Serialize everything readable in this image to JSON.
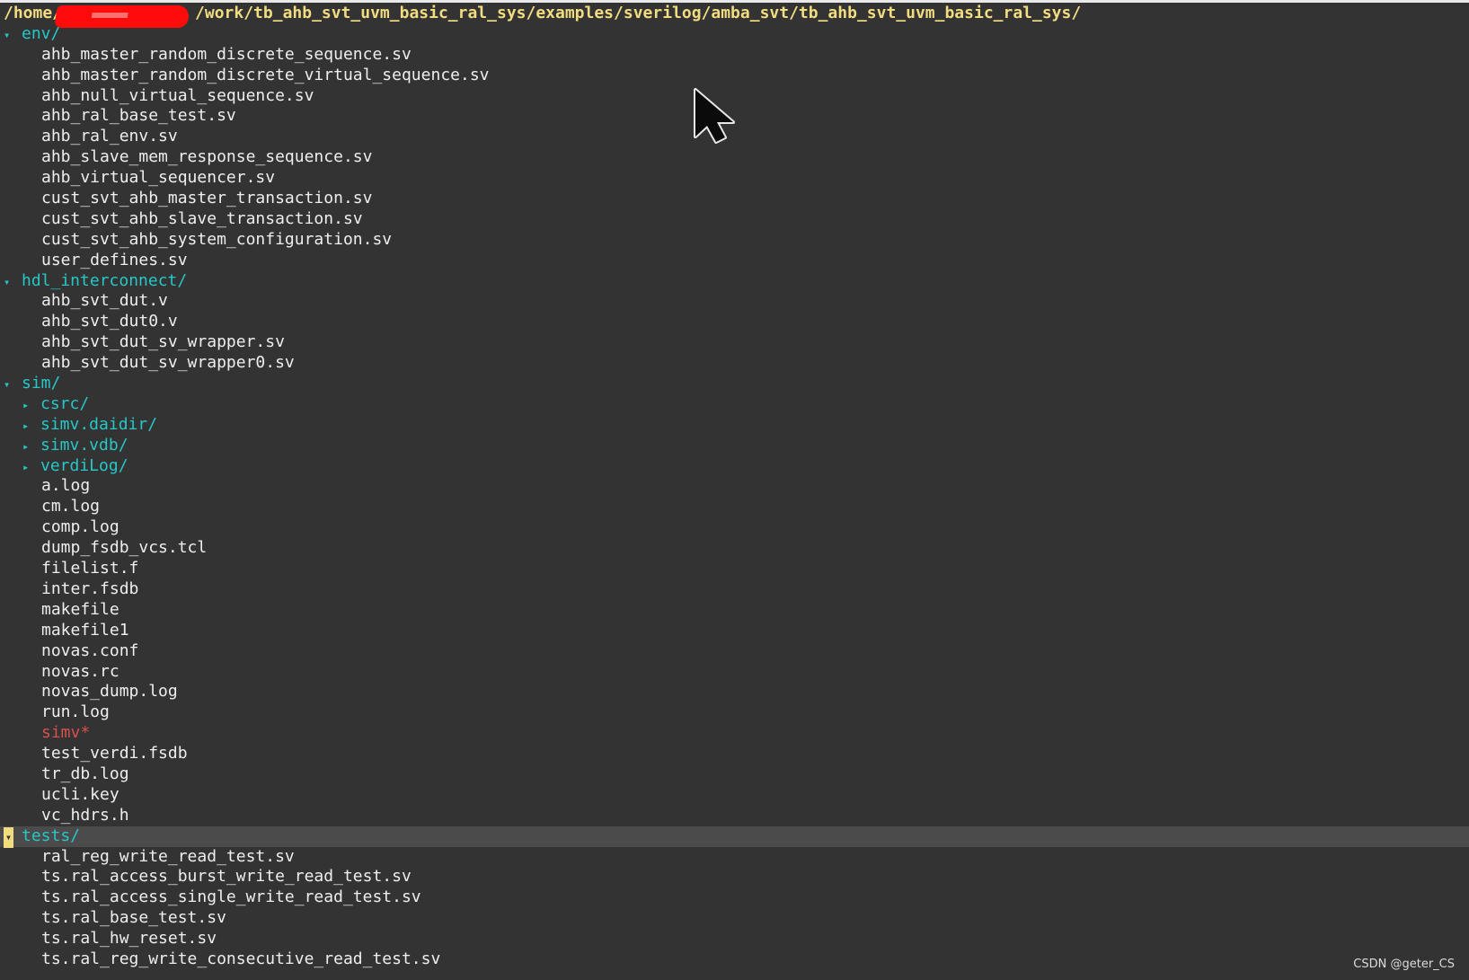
{
  "path": "/home/[redacted]/work/tb_ahb_svt_uvm_basic_ral_sys/examples/sverilog/amba_svt/tb_ahb_svt_uvm_basic_ral_sys/",
  "path_parts": {
    "prefix": "/home/",
    "suffix": "/work/tb_ahb_svt_uvm_basic_ral_sys/examples/sverilog/amba_svt/tb_ahb_svt_uvm_basic_ral_sys/"
  },
  "env": {
    "label": "env/",
    "files": [
      "ahb_master_random_discrete_sequence.sv",
      "ahb_master_random_discrete_virtual_sequence.sv",
      "ahb_null_virtual_sequence.sv",
      "ahb_ral_base_test.sv",
      "ahb_ral_env.sv",
      "ahb_slave_mem_response_sequence.sv",
      "ahb_virtual_sequencer.sv",
      "cust_svt_ahb_master_transaction.sv",
      "cust_svt_ahb_slave_transaction.sv",
      "cust_svt_ahb_system_configuration.sv",
      "user_defines.sv"
    ]
  },
  "hdl": {
    "label": "hdl_interconnect/",
    "files": [
      "ahb_svt_dut.v",
      "ahb_svt_dut0.v",
      "ahb_svt_dut_sv_wrapper.sv",
      "ahb_svt_dut_sv_wrapper0.sv"
    ]
  },
  "sim": {
    "label": "sim/",
    "subdirs": [
      "csrc/",
      "simv.daidir/",
      "simv.vdb/",
      "verdiLog/"
    ],
    "files_before": [
      "a.log",
      "cm.log",
      "comp.log",
      "dump_fsdb_vcs.tcl",
      "filelist.f",
      "inter.fsdb",
      "makefile",
      "makefile1",
      "novas.conf",
      "novas.rc",
      "novas_dump.log",
      "run.log"
    ],
    "executable": "simv*",
    "files_after": [
      "test_verdi.fsdb",
      "tr_db.log",
      "ucli.key",
      "vc_hdrs.h"
    ]
  },
  "tests": {
    "label": "tests/",
    "files": [
      "ral_reg_write_read_test.sv",
      "ts.ral_access_burst_write_read_test.sv",
      "ts.ral_access_single_write_read_test.sv",
      "ts.ral_base_test.sv",
      "ts.ral_hw_reset.sv",
      "ts.ral_reg_write_consecutive_read_test.sv"
    ]
  },
  "glyphs": {
    "expanded": "▾",
    "collapsed": "▸"
  },
  "watermark": "CSDN @geter_CS",
  "colors": {
    "background": "#333333",
    "path": "#f2dc80",
    "directory": "#27c7c7",
    "file": "#eeeeee",
    "executable": "#d8514e",
    "selection": "#4b4b4b"
  }
}
